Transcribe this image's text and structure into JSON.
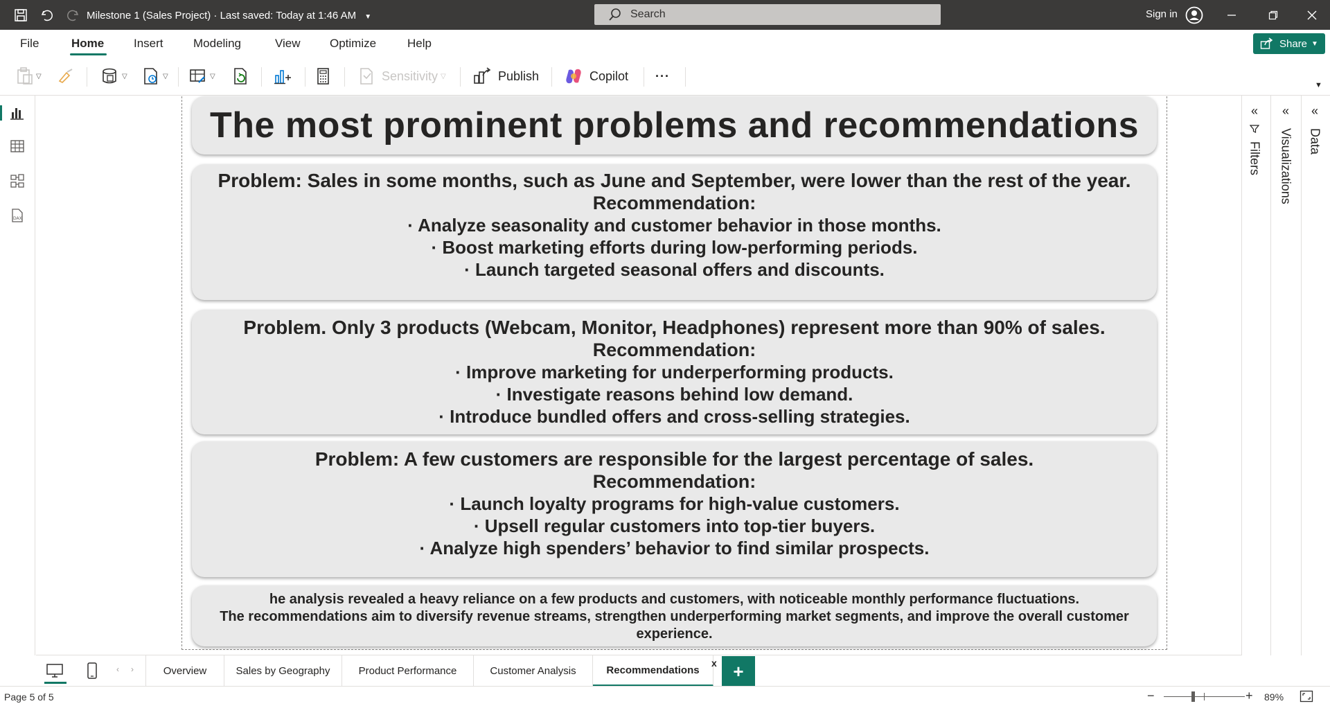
{
  "titlebar": {
    "title": "Milestone 1 (Sales Project)",
    "saved": "Last saved: Today at 1:46 AM",
    "search_placeholder": "Search",
    "signin": "Sign in"
  },
  "menu": {
    "items": [
      "File",
      "Home",
      "Insert",
      "Modeling",
      "View",
      "Optimize",
      "Help"
    ],
    "active": "Home",
    "share_label": "Share"
  },
  "ribbon": {
    "sensitivity_label": "Sensitivity",
    "publish_label": "Publish",
    "copilot_label": "Copilot",
    "more_label": "···"
  },
  "report": {
    "title": "The most prominent problems and recommendations",
    "sections": [
      {
        "problem": "Problem: Sales in some months, such as June and September, were lower than the rest of the year.",
        "reco_header": "Recommendation:",
        "items": [
          "Analyze seasonality and customer behavior in those months.",
          "Boost marketing efforts during low-performing periods.",
          "Launch targeted seasonal offers and discounts."
        ]
      },
      {
        "problem": "Problem. Only 3 products (Webcam, Monitor, Headphones) represent more than 90% of sales.",
        "reco_header": "Recommendation:",
        "items": [
          "Improve marketing for underperforming products.",
          "Investigate reasons behind low demand.",
          "Introduce bundled offers and cross-selling strategies."
        ]
      },
      {
        "problem": "Problem: A few customers are responsible for the largest percentage of sales.",
        "reco_header": "Recommendation:",
        "items": [
          "Launch loyalty programs for high-value customers.",
          "Upsell regular customers into top-tier buyers.",
          "Analyze high spenders’ behavior to find similar prospects."
        ]
      }
    ],
    "summary_line1": "he analysis revealed a heavy reliance on a few products and customers, with noticeable monthly performance fluctuations.",
    "summary_line2": "The recommendations aim to diversify revenue streams, strengthen underperforming market segments, and improve the overall customer experience."
  },
  "panes": {
    "filters": "Filters",
    "visualizations": "Visualizations",
    "data": "Data"
  },
  "tabs": {
    "items": [
      "Overview",
      "Sales by Geography",
      "Product Performance",
      "Customer Analysis",
      "Recommendations"
    ],
    "active": "Recommendations",
    "close_label": "x",
    "add_label": "+"
  },
  "status": {
    "page": "Page 5 of 5",
    "zoom": "89%"
  },
  "colors": {
    "accent": "#117865",
    "titlebar": "#3b3a39",
    "card": "#e9e9e9"
  }
}
